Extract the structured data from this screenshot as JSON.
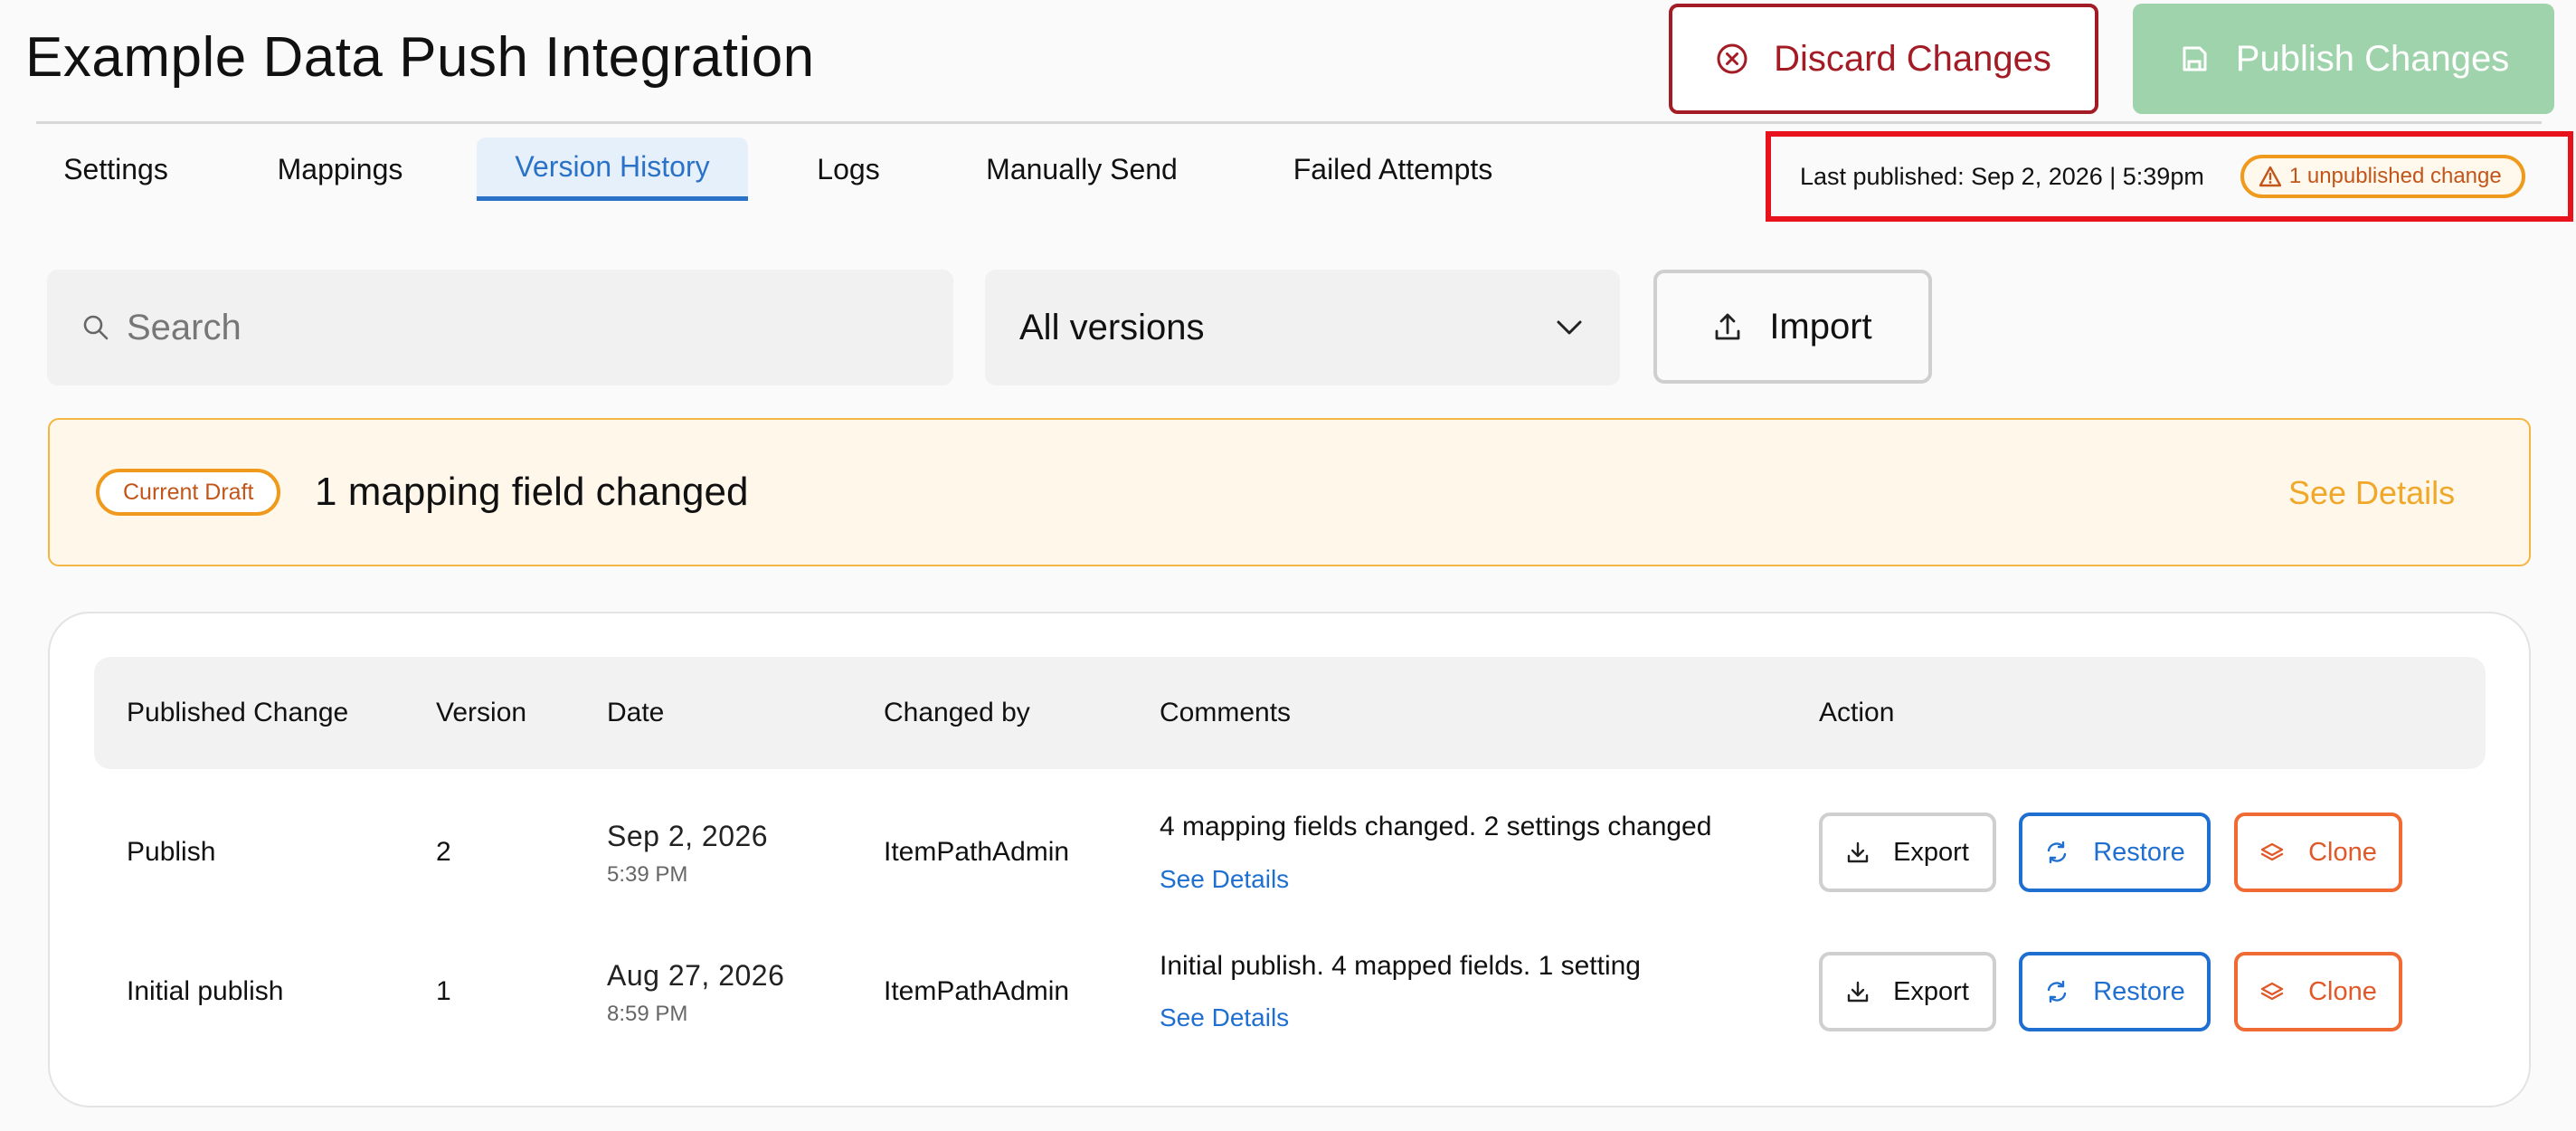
{
  "header": {
    "title": "Example Data Push Integration",
    "discard_label": "Discard Changes",
    "publish_label": "Publish Changes"
  },
  "tabs": [
    {
      "label": "Settings",
      "active": false
    },
    {
      "label": "Mappings",
      "active": false
    },
    {
      "label": "Version History",
      "active": true
    },
    {
      "label": "Logs",
      "active": false
    },
    {
      "label": "Manually Send",
      "active": false
    },
    {
      "label": "Failed Attempts",
      "active": false
    }
  ],
  "status": {
    "last_published": "Last published: Sep 2, 2026 | 5:39pm",
    "unpublished_badge": "1 unpublished change"
  },
  "controls": {
    "search_placeholder": "Search",
    "version_filter": "All versions",
    "import_label": "Import"
  },
  "draft": {
    "badge": "Current Draft",
    "summary": "1 mapping field changed",
    "link": "See Details"
  },
  "table": {
    "columns": [
      "Published Change",
      "Version",
      "Date",
      "Changed by",
      "Comments",
      "Action"
    ],
    "rows": [
      {
        "change": "Publish",
        "version": "2",
        "date": "Sep 2, 2026",
        "time": "5:39 PM",
        "changed_by": "ItemPathAdmin",
        "comment": "4 mapping fields changed. 2 settings changed",
        "details_link": "See Details"
      },
      {
        "change": "Initial publish",
        "version": "1",
        "date": "Aug 27, 2026",
        "time": "8:59 PM",
        "changed_by": "ItemPathAdmin",
        "comment": "Initial publish. 4 mapped fields. 1 setting",
        "details_link": "See Details"
      }
    ],
    "actions": {
      "export": "Export",
      "restore": "Restore",
      "clone": "Clone"
    }
  },
  "icons": {
    "discard": "circle-x-icon",
    "publish": "save-icon",
    "warning": "warning-triangle-icon",
    "search": "search-icon",
    "dropdown": "chevron-down-icon",
    "import": "upload-icon",
    "export": "download-icon",
    "restore": "refresh-icon",
    "clone": "layers-icon"
  },
  "colors": {
    "discard": "#a31b25",
    "publish_disabled": "#9fd3ab",
    "tab_active": "#2a72c7",
    "highlight_box": "#e8121c",
    "warning": "#ef9a1c",
    "link": "#1f6fd1",
    "clone": "#f06a33"
  }
}
